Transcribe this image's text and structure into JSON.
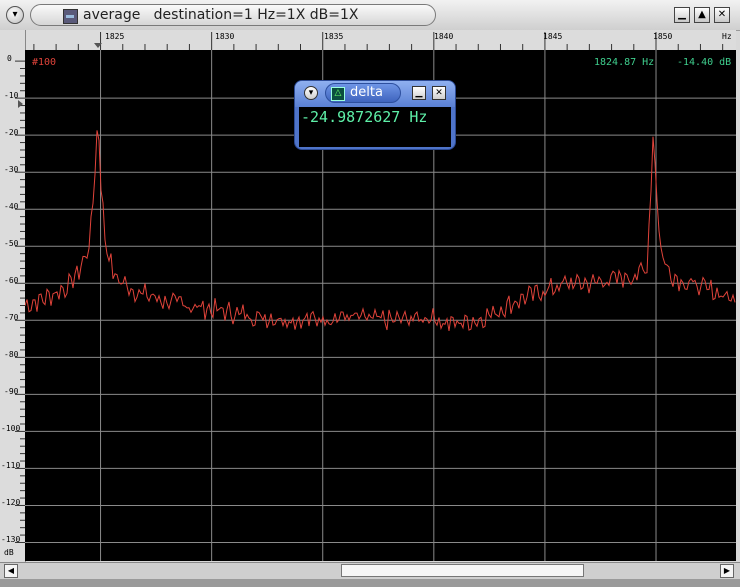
{
  "window": {
    "title": "average   destination=1 Hz=1X dB=1X",
    "menu_icon": "chevron-down-icon",
    "buttons": {
      "minimize": "▁",
      "maximize": "▲",
      "close": "✕"
    }
  },
  "ruler": {
    "x_ticks": [
      "1825",
      "1830",
      "1835",
      "1840",
      "1845",
      "1850"
    ],
    "x_unit": "Hz",
    "y_ticks": [
      "0",
      "-10",
      "-20",
      "-30",
      "-40",
      "-50",
      "-60",
      "-70",
      "-80",
      "-90",
      "-100",
      "-110",
      "-120",
      "-130"
    ],
    "y_unit": "dB"
  },
  "plot": {
    "label": "#100",
    "cursor_freq": "1824.87 Hz",
    "cursor_level": "-14.40 dB"
  },
  "delta_window": {
    "title": "delta",
    "value": "-24.9872627 Hz"
  },
  "scrollbar": {
    "left_arrow": "◀",
    "right_arrow": "▶"
  },
  "chart_data": {
    "type": "line",
    "title": "",
    "xlabel": "Hz",
    "ylabel": "dB",
    "xlim": [
      1821.6,
      1853.6
    ],
    "ylim": [
      -135,
      3
    ],
    "colors": {
      "trace": "#e0433a",
      "grid": "#8a8a8a",
      "background": "#000000"
    },
    "series": [
      {
        "x": [
          1821.6,
          1822.5,
          1823.5,
          1824.0,
          1824.5,
          1824.87,
          1825.2,
          1825.6,
          1826.5,
          1828,
          1830,
          1832,
          1834,
          1836,
          1838,
          1840,
          1840.5,
          1842,
          1843,
          1844,
          1845,
          1846,
          1847,
          1848,
          1849,
          1849.6,
          1849.87,
          1850.2,
          1850.6,
          1851,
          1852,
          1853,
          1853.6
        ],
        "y": [
          -66,
          -64,
          -61,
          -57,
          -50,
          -20,
          -48,
          -58,
          -62,
          -65,
          -67,
          -69,
          -70,
          -69,
          -70,
          -69,
          -71,
          -70,
          -67,
          -64,
          -62,
          -60,
          -60,
          -59,
          -58,
          -56,
          -20,
          -51,
          -57,
          -59,
          -61,
          -63,
          -65
        ]
      }
    ]
  }
}
